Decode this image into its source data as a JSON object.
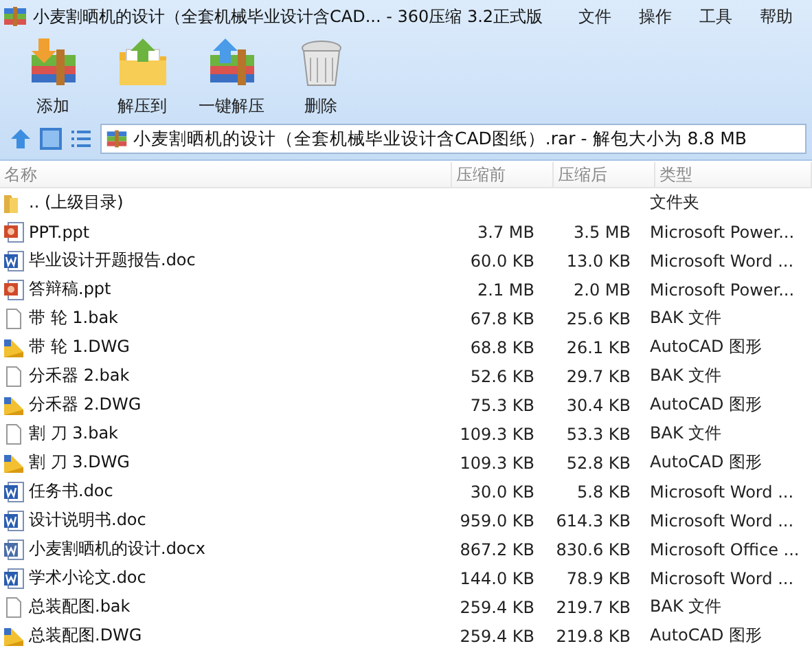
{
  "window": {
    "title": "小麦割晒机的设计（全套机械毕业设计含CAD... - 360压缩 3.2正式版"
  },
  "menu": [
    "文件",
    "操作",
    "工具",
    "帮助"
  ],
  "toolbar": [
    {
      "label": "添加",
      "kind": "add"
    },
    {
      "label": "解压到",
      "kind": "extract"
    },
    {
      "label": "一键解压",
      "kind": "oneclick"
    },
    {
      "label": "删除",
      "kind": "delete"
    }
  ],
  "address": {
    "path": "小麦割晒机的设计（全套机械毕业设计含CAD图纸）.rar - 解包大小为 8.8 MB"
  },
  "table": {
    "columns": [
      "名称",
      "压缩前",
      "压缩后",
      "类型"
    ],
    "rows": [
      {
        "kind": "folder",
        "name": ".. (上级目录)",
        "size": "",
        "packed": "",
        "type": "文件夹"
      },
      {
        "kind": "ppt",
        "name": "PPT.ppt",
        "size": "3.7 MB",
        "packed": "3.5 MB",
        "type": "Microsoft Power..."
      },
      {
        "kind": "doc",
        "name": "毕业设计开题报告.doc",
        "size": "60.0 KB",
        "packed": "13.0 KB",
        "type": "Microsoft Word ..."
      },
      {
        "kind": "ppt",
        "name": "答辩稿.ppt",
        "size": "2.1 MB",
        "packed": "2.0 MB",
        "type": "Microsoft Power..."
      },
      {
        "kind": "bak",
        "name": "带 轮 1.bak",
        "size": "67.8 KB",
        "packed": "25.6 KB",
        "type": "BAK 文件"
      },
      {
        "kind": "dwg",
        "name": "带 轮 1.DWG",
        "size": "68.8 KB",
        "packed": "26.1 KB",
        "type": "AutoCAD 图形"
      },
      {
        "kind": "bak",
        "name": "分禾器 2.bak",
        "size": "52.6 KB",
        "packed": "29.7 KB",
        "type": "BAK 文件"
      },
      {
        "kind": "dwg",
        "name": "分禾器 2.DWG",
        "size": "75.3 KB",
        "packed": "30.4 KB",
        "type": "AutoCAD 图形"
      },
      {
        "kind": "bak",
        "name": "割 刀 3.bak",
        "size": "109.3 KB",
        "packed": "53.3 KB",
        "type": "BAK 文件"
      },
      {
        "kind": "dwg",
        "name": "割 刀 3.DWG",
        "size": "109.3 KB",
        "packed": "52.8 KB",
        "type": "AutoCAD 图形"
      },
      {
        "kind": "doc",
        "name": "任务书.doc",
        "size": "30.0 KB",
        "packed": "5.8 KB",
        "type": "Microsoft Word ..."
      },
      {
        "kind": "doc",
        "name": "设计说明书.doc",
        "size": "959.0 KB",
        "packed": "614.3 KB",
        "type": "Microsoft Word ..."
      },
      {
        "kind": "docx",
        "name": "小麦割晒机的设计.docx",
        "size": "867.2 KB",
        "packed": "830.6 KB",
        "type": "Microsoft Office ..."
      },
      {
        "kind": "doc",
        "name": "学术小论文.doc",
        "size": "144.0 KB",
        "packed": "78.9 KB",
        "type": "Microsoft Word ..."
      },
      {
        "kind": "bak",
        "name": "总装配图.bak",
        "size": "259.4 KB",
        "packed": "219.7 KB",
        "type": "BAK 文件"
      },
      {
        "kind": "dwg",
        "name": "总装配图.DWG",
        "size": "259.4 KB",
        "packed": "219.8 KB",
        "type": "AutoCAD 图形"
      }
    ]
  }
}
